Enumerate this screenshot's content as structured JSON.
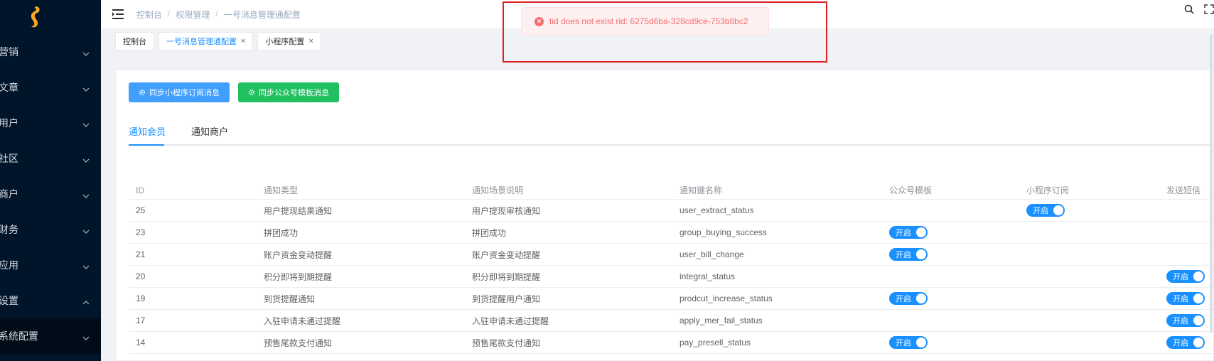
{
  "sidebar": {
    "items": [
      {
        "label": "营销"
      },
      {
        "label": "文章"
      },
      {
        "label": "用户"
      },
      {
        "label": "社区"
      },
      {
        "label": "商户"
      },
      {
        "label": "财务"
      },
      {
        "label": "应用"
      },
      {
        "label": "设置"
      },
      {
        "label": "系统配置"
      }
    ]
  },
  "header": {
    "breadcrumb": [
      "控制台",
      "权限管理",
      "一号消息管理通配置"
    ]
  },
  "tags": [
    {
      "label": "控制台"
    },
    {
      "label": "一号消息管理通配置"
    },
    {
      "label": "小程序配置"
    }
  ],
  "toolbar": {
    "sync_mini_label": "同步小程序订阅消息",
    "sync_official_label": "同步公众号模板消息"
  },
  "tabs": [
    {
      "label": "通知会员"
    },
    {
      "label": "通知商户"
    }
  ],
  "table": {
    "headers": [
      "ID",
      "通知类型",
      "通知场景说明",
      "通知键名称",
      "公众号模板",
      "小程序订阅",
      "发送短信"
    ],
    "toggle_label": "开启",
    "rows": [
      {
        "id": "25",
        "type": "用户提现结果通知",
        "scene": "用户提现审核通知",
        "key": "user_extract_status",
        "official": false,
        "mini": true,
        "sms": false
      },
      {
        "id": "23",
        "type": "拼团成功",
        "scene": "拼团成功",
        "key": "group_buying_success",
        "official": true,
        "mini": false,
        "sms": false
      },
      {
        "id": "21",
        "type": "账户资金变动提醒",
        "scene": "账户资金变动提醒",
        "key": "user_bill_change",
        "official": true,
        "mini": false,
        "sms": false
      },
      {
        "id": "20",
        "type": "积分即将到期提醒",
        "scene": "积分即将到期提醒",
        "key": "integral_status",
        "official": false,
        "mini": false,
        "sms": true
      },
      {
        "id": "19",
        "type": "到货提醒通知",
        "scene": "到货提醒用户通知",
        "key": "prodcut_increase_status",
        "official": true,
        "mini": false,
        "sms": true
      },
      {
        "id": "17",
        "type": "入驻申请未通过提醒",
        "scene": "入驻申请未通过提醒",
        "key": "apply_mer_fail_status",
        "official": false,
        "mini": false,
        "sms": true
      },
      {
        "id": "14",
        "type": "预售尾款支付通知",
        "scene": "预售尾款支付通知",
        "key": "pay_presell_status",
        "official": true,
        "mini": false,
        "sms": true
      }
    ]
  },
  "message": {
    "text": "tid does not exist rid: 6275d6ba-328cd9ce-753b8bc2"
  },
  "colors": {
    "sidebar_bg": "#001529",
    "primary": "#1890ff",
    "success": "#20c060",
    "error": "#f56c6c"
  }
}
